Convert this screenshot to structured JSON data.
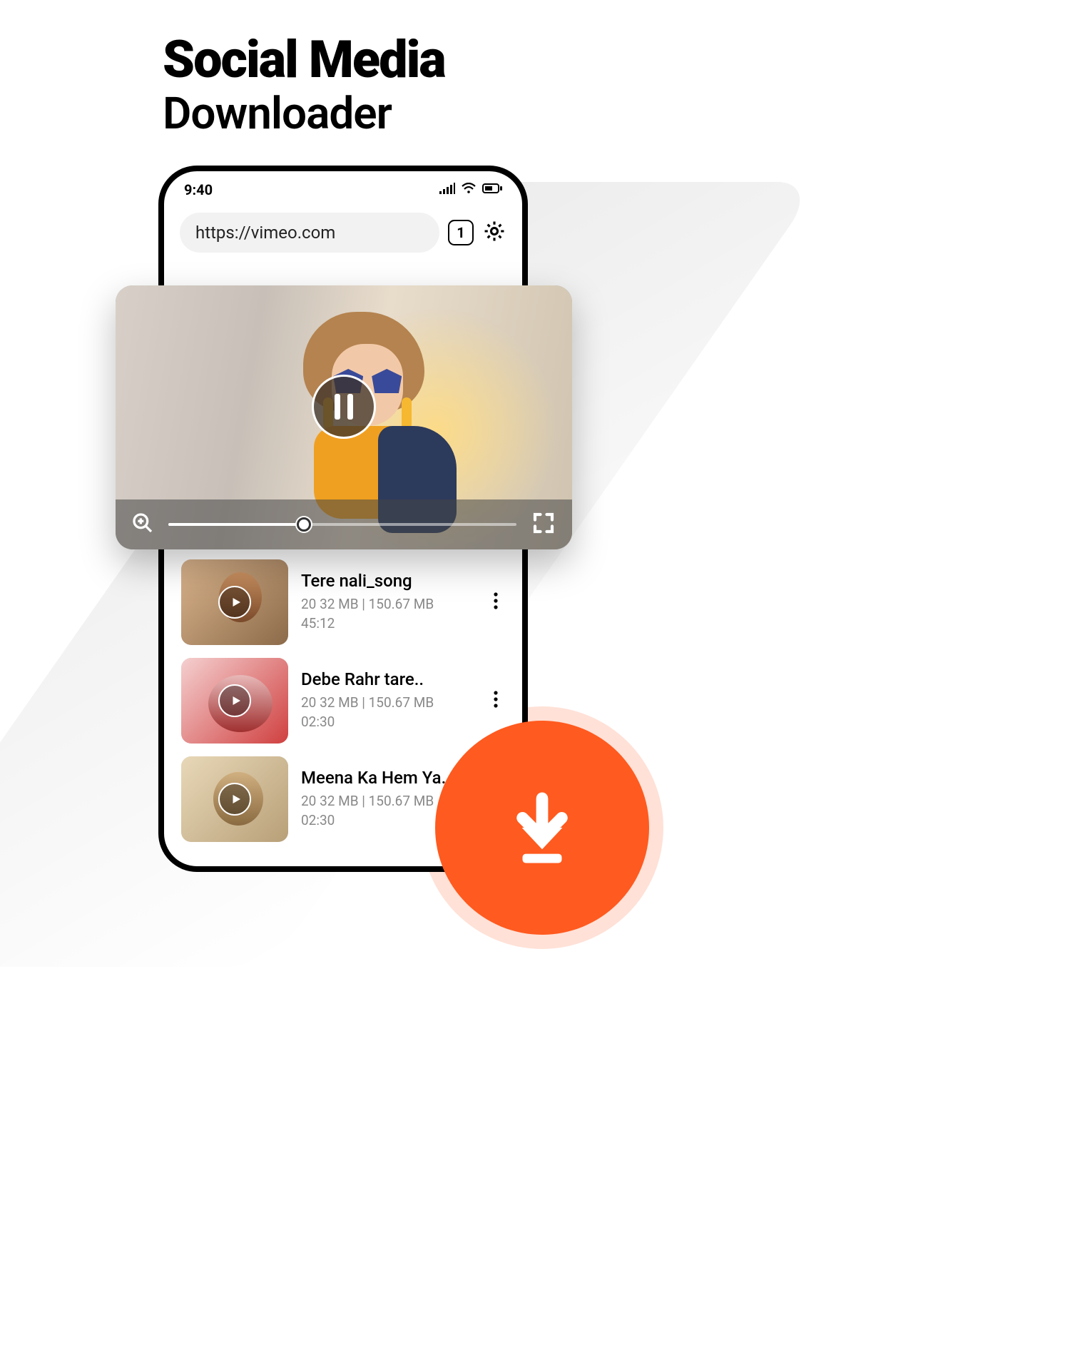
{
  "title": {
    "line1": "Social Media",
    "line2": "Downloader"
  },
  "status_bar": {
    "time": "9:40"
  },
  "url_bar": {
    "value": "https://vimeo.com",
    "tab_count": "1"
  },
  "videos": [
    {
      "title": "Tere nali_song",
      "meta_line1": "20 32 MB | 150.67 MB",
      "meta_line2": "45:12"
    },
    {
      "title": "Debe Rahr tare..",
      "meta_line1": "20 32 MB | 150.67 MB",
      "meta_line2": "02:30"
    },
    {
      "title": "Meena Ka Hem Ya..",
      "meta_line1": "20 32 MB | 150.67 MB",
      "meta_line2": "02:30"
    }
  ],
  "colors": {
    "accent": "#ff5a1f"
  }
}
